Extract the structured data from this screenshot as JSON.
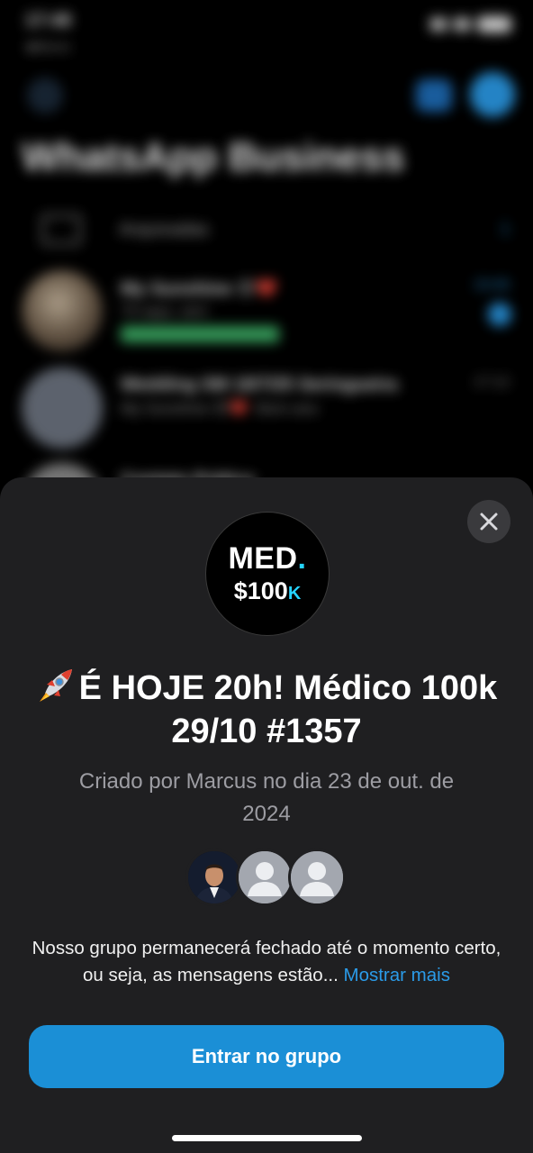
{
  "status_bar": {
    "time": "17:48",
    "carrier": "◀ Busca"
  },
  "background": {
    "title": "WhatsApp Business",
    "archived": {
      "label": "Arquivadas",
      "count": "1"
    },
    "chats": [
      {
        "name": "My Sunshine 😍❤️",
        "sub": "Tô aqui, sim!",
        "time": "19:46"
      },
      {
        "name": "Wedding SM 18/7/25 Seringueira",
        "sub": "My Sunshine 😍❤️: Bom ano",
        "time": "17:12"
      },
      {
        "name": "Contato Prático",
        "sub": "",
        "time": ""
      }
    ]
  },
  "sheet": {
    "avatar": {
      "line1": "MED",
      "dot": ".",
      "line2": "$100",
      "k": "K"
    },
    "title": "É HOJE 20h! Médico 100k 29/10 #1357",
    "created": "Criado por Marcus no dia 23 de out. de 2024",
    "description": "Nosso grupo permanecerá fechado até o momento certo, ou seja, as mensagens estão...",
    "show_more": "Mostrar mais",
    "join_button": "Entrar no grupo"
  },
  "colors": {
    "accent": "#1b8fd6",
    "link": "#2b9be8",
    "sheet_bg": "#1f1f21"
  }
}
